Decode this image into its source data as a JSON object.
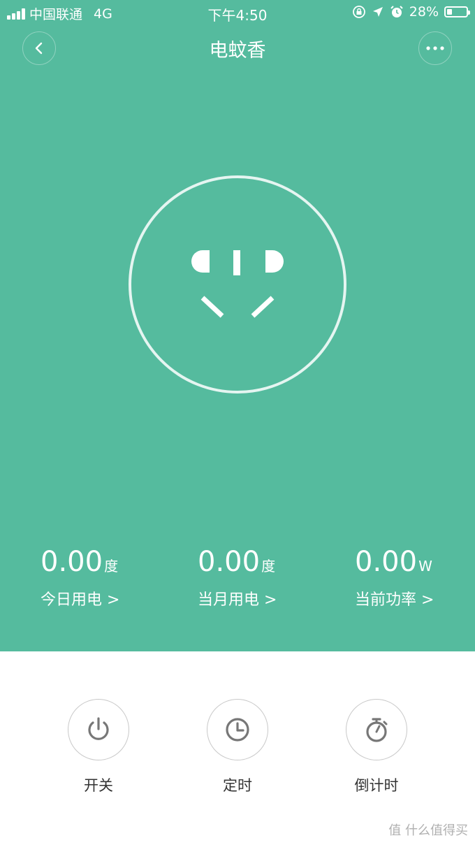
{
  "status_bar": {
    "carrier": "中国联通",
    "network": "4G",
    "time": "下午4:50",
    "battery_percent": "28%",
    "battery_level": 0.28
  },
  "header": {
    "title": "电蚊香",
    "back_icon": "chevron-left-icon",
    "more_icon": "more-dots-icon"
  },
  "stats": [
    {
      "value": "0.00",
      "unit": "度",
      "label": "今日用电 >"
    },
    {
      "value": "0.00",
      "unit": "度",
      "label": "当月用电 >"
    },
    {
      "value": "0.00",
      "unit": "W",
      "label": "当前功率 >"
    }
  ],
  "controls": [
    {
      "label": "开关",
      "icon": "power-icon"
    },
    {
      "label": "定时",
      "icon": "clock-icon"
    },
    {
      "label": "倒计时",
      "icon": "stopwatch-icon"
    }
  ],
  "watermark": "值 什么值得买",
  "colors": {
    "primary": "#55bb9e",
    "icon_gray": "#777777",
    "text_dark": "#333333"
  }
}
